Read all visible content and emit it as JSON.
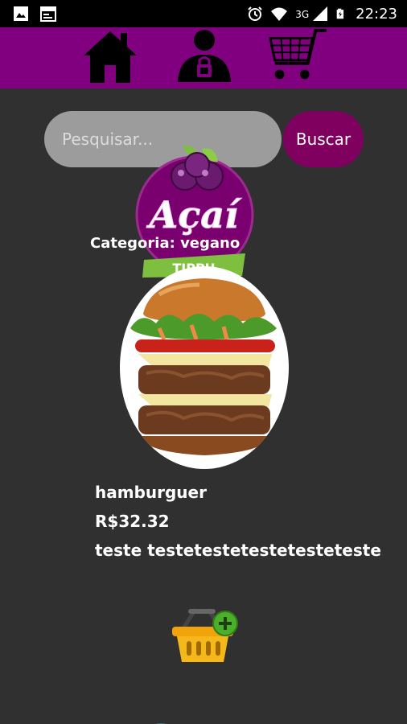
{
  "status_bar": {
    "time": "22:23",
    "network": "3G",
    "icons": [
      "image-icon",
      "calendar-icon",
      "alarm-icon",
      "wifi-icon",
      "signal-icon",
      "battery-icon"
    ]
  },
  "nav": {
    "items": [
      "home-icon",
      "user-lock-icon",
      "cart-icon"
    ],
    "bar_color": "#800080"
  },
  "search": {
    "placeholder": "Pesquisar...",
    "button_label": "Buscar"
  },
  "logo": {
    "text": "Açaí",
    "subtext": "TIPPU"
  },
  "product": {
    "category": "Categoria: vegano",
    "name": "hamburguer",
    "price": "R$32.32",
    "description": "teste testetestetestetesteteste"
  },
  "actions": {
    "add_to_cart_icon": "basket-add-icon"
  },
  "colors": {
    "accent": "#800080",
    "button": "#800060",
    "background": "#303030"
  }
}
